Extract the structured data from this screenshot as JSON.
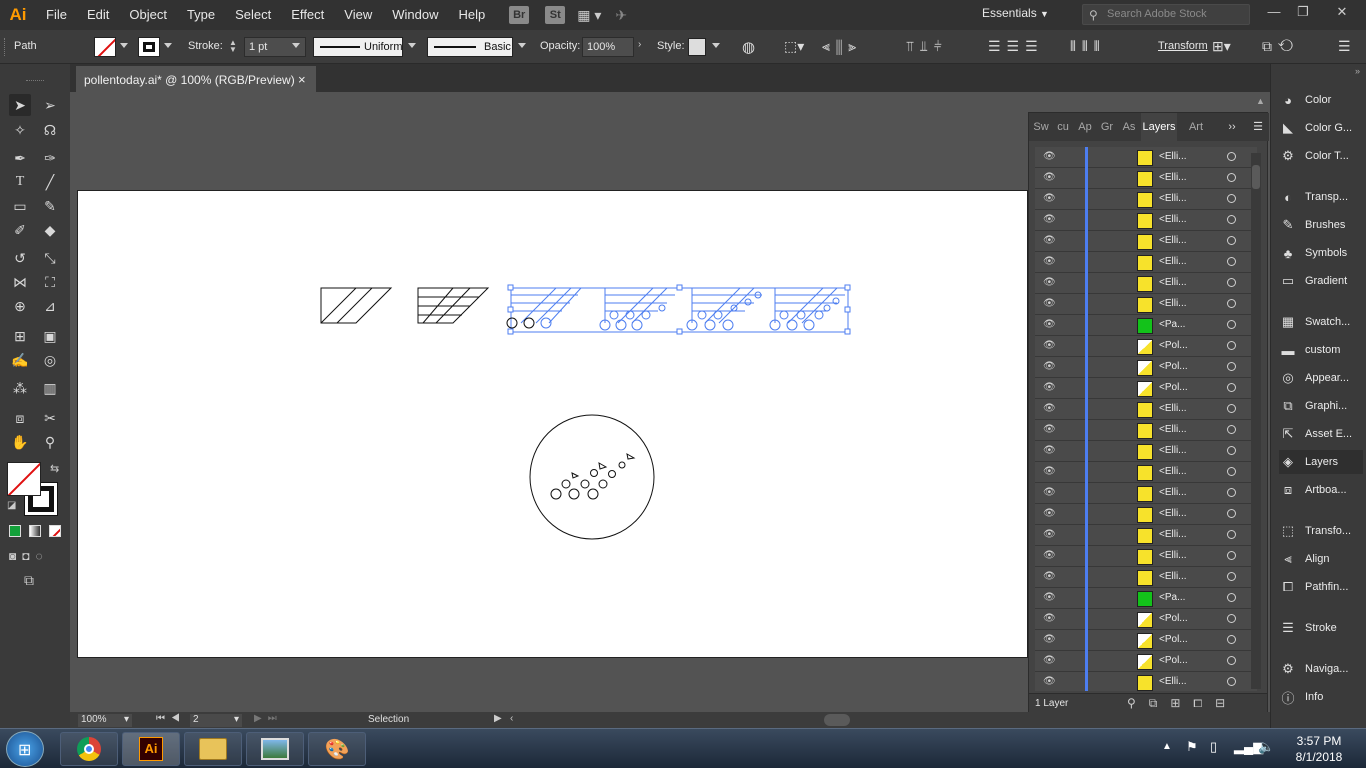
{
  "app": {
    "logo": "Ai",
    "menus": [
      "File",
      "Edit",
      "Object",
      "Type",
      "Select",
      "Effect",
      "View",
      "Window",
      "Help"
    ],
    "bridge_label": "Br",
    "stock_label": "St",
    "workspace": "Essentials",
    "search_placeholder": "Search Adobe Stock"
  },
  "control_bar": {
    "selection_type": "Path",
    "stroke_label": "Stroke:",
    "stroke_weight": "1 pt",
    "profile": "Uniform",
    "brush": "Basic",
    "opacity_label": "Opacity:",
    "opacity": "100%",
    "style_label": "Style:",
    "transform_label": "Transform"
  },
  "document": {
    "tab_title": "pollentoday.ai* @ 100% (RGB/Preview)",
    "close": "×"
  },
  "layers_panel": {
    "tabs": [
      "Sw",
      "cu",
      "Ap",
      "Gr",
      "As",
      "Layers",
      "Art"
    ],
    "active_tab": "Layers",
    "rows": [
      {
        "name": "<Elli...",
        "thumb": "yellow"
      },
      {
        "name": "<Elli...",
        "thumb": "yellow"
      },
      {
        "name": "<Elli...",
        "thumb": "yellow"
      },
      {
        "name": "<Elli...",
        "thumb": "yellow"
      },
      {
        "name": "<Elli...",
        "thumb": "yellow"
      },
      {
        "name": "<Elli...",
        "thumb": "yellow"
      },
      {
        "name": "<Elli...",
        "thumb": "yellow"
      },
      {
        "name": "<Elli...",
        "thumb": "yellow"
      },
      {
        "name": "<Pa...",
        "thumb": "green"
      },
      {
        "name": "<Pol...",
        "thumb": "poly"
      },
      {
        "name": "<Pol...",
        "thumb": "poly"
      },
      {
        "name": "<Pol...",
        "thumb": "poly"
      },
      {
        "name": "<Elli...",
        "thumb": "yellow"
      },
      {
        "name": "<Elli...",
        "thumb": "yellow"
      },
      {
        "name": "<Elli...",
        "thumb": "yellow"
      },
      {
        "name": "<Elli...",
        "thumb": "yellow"
      },
      {
        "name": "<Elli...",
        "thumb": "yellow"
      },
      {
        "name": "<Elli...",
        "thumb": "yellow"
      },
      {
        "name": "<Elli...",
        "thumb": "yellow"
      },
      {
        "name": "<Elli...",
        "thumb": "yellow"
      },
      {
        "name": "<Elli...",
        "thumb": "yellow"
      },
      {
        "name": "<Pa...",
        "thumb": "green"
      },
      {
        "name": "<Pol...",
        "thumb": "poly"
      },
      {
        "name": "<Pol...",
        "thumb": "poly"
      },
      {
        "name": "<Pol...",
        "thumb": "poly"
      },
      {
        "name": "<Elli...",
        "thumb": "yellow"
      }
    ],
    "footer": "1 Layer"
  },
  "dock": {
    "items": [
      "Color",
      "Color G...",
      "Color T...",
      "Transp...",
      "Brushes",
      "Symbols",
      "Gradient",
      "Swatch...",
      "custom",
      "Appear...",
      "Graphi...",
      "Asset E...",
      "Layers",
      "Artboa...",
      "Transfo...",
      "Align",
      "Pathfin...",
      "Stroke",
      "Naviga...",
      "Info"
    ],
    "active": "Layers"
  },
  "status_bar": {
    "zoom": "100%",
    "artboard_num": "2",
    "tool_name": "Selection"
  },
  "taskbar": {
    "time": "3:57 PM",
    "date": "8/1/2018"
  },
  "colors": {
    "accent": "#4d7ef0",
    "ai_orange": "#ff9a00",
    "yellow": "#f7e22b",
    "green": "#13c21a"
  }
}
